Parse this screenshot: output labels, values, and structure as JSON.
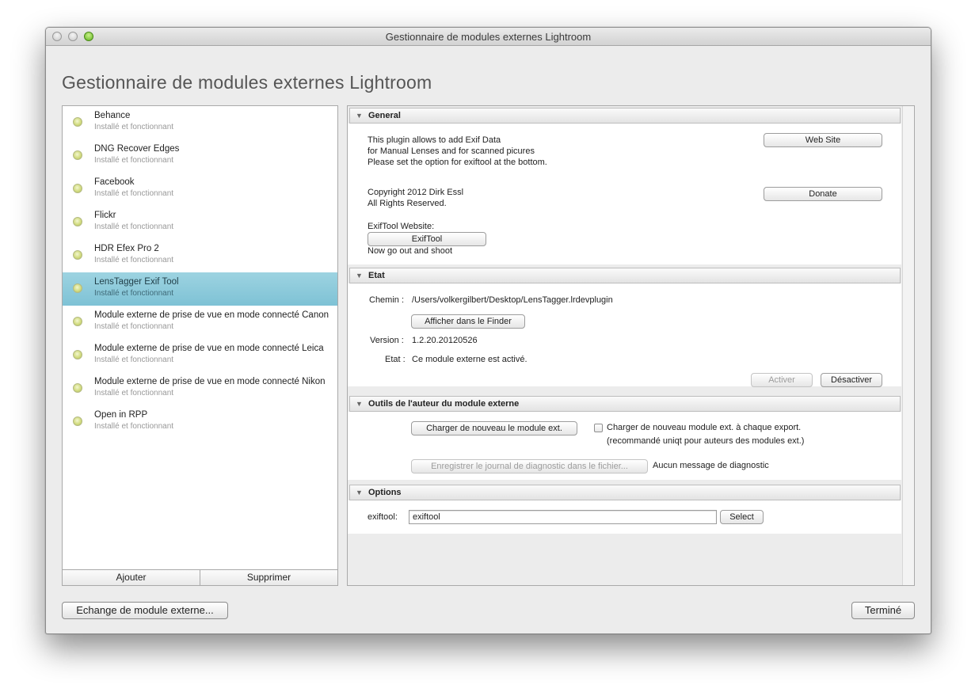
{
  "window": {
    "title": "Gestionnaire de modules externes Lightroom"
  },
  "heading": "Gestionnaire de modules externes Lightroom",
  "plugins": [
    {
      "name": "Behance",
      "status": "Installé et fonctionnant",
      "selected": false
    },
    {
      "name": "DNG Recover Edges",
      "status": "Installé et fonctionnant",
      "selected": false
    },
    {
      "name": "Facebook",
      "status": "Installé et fonctionnant",
      "selected": false
    },
    {
      "name": "Flickr",
      "status": "Installé et fonctionnant",
      "selected": false
    },
    {
      "name": "HDR Efex Pro 2",
      "status": "Installé et fonctionnant",
      "selected": false
    },
    {
      "name": "LensTagger Exif Tool",
      "status": "Installé et fonctionnant",
      "selected": true
    },
    {
      "name": "Module externe de prise de vue en mode connecté Canon",
      "status": "Installé et fonctionnant",
      "selected": false
    },
    {
      "name": "Module externe de prise de vue en mode connecté Leica",
      "status": "Installé et fonctionnant",
      "selected": false
    },
    {
      "name": "Module externe de prise de vue en mode connecté Nikon",
      "status": "Installé et fonctionnant",
      "selected": false
    },
    {
      "name": "Open in RPP",
      "status": "Installé et fonctionnant",
      "selected": false
    }
  ],
  "list_buttons": {
    "add": "Ajouter",
    "remove": "Supprimer"
  },
  "general": {
    "header": "General",
    "desc_line1": "This plugin allows to add Exif Data",
    "desc_line2": "for Manual Lenses and for scanned picures",
    "desc_line3": "Please set the option for exiftool at the bottom.",
    "website_button": "Web Site",
    "copyright_line1": "Copyright 2012 Dirk Essl",
    "copyright_line2": "All Rights Reserved.",
    "donate_button": "Donate",
    "exiftool_label": "ExifTool Website:",
    "exiftool_button": "ExifTool",
    "footer_text": "Now go out and shoot"
  },
  "etat": {
    "header": "Etat",
    "path_label": "Chemin :",
    "path_value": "/Users/volkergilbert/Desktop/LensTagger.lrdevplugin",
    "finder_button": "Afficher dans le Finder",
    "version_label": "Version :",
    "version_value": "1.2.20.20120526",
    "state_label": "Etat :",
    "state_value": "Ce module externe est activé.",
    "activate_button": "Activer",
    "deactivate_button": "Désactiver"
  },
  "outils": {
    "header": "Outils de l'auteur du module externe",
    "reload_button": "Charger de nouveau le module ext.",
    "reload_each_export_label": "Charger de nouveau module ext. à chaque export.",
    "reload_each_export_note": "(recommandé uniqt pour auteurs des modules ext.)",
    "save_log_button": "Enregistrer le journal de diagnostic dans le fichier...",
    "log_status": "Aucun message de diagnostic"
  },
  "options": {
    "header": "Options",
    "exiftool_label": "exiftool:",
    "exiftool_value": "exiftool",
    "select_button": "Select"
  },
  "footer": {
    "exchange_button": "Echange de module externe...",
    "done_button": "Terminé"
  }
}
